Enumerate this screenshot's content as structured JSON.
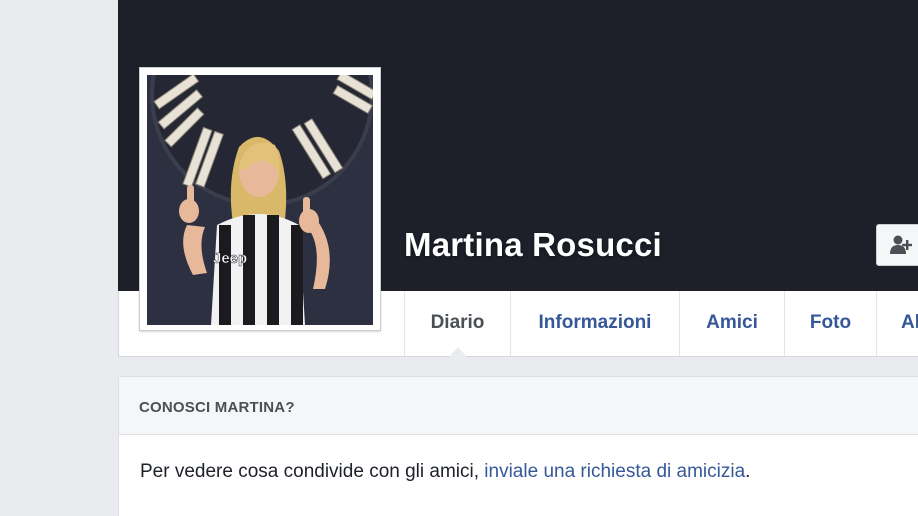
{
  "profile": {
    "name": "Martina Rosucci",
    "photo_icon": "profile-photo",
    "jersey_text": "Jeep"
  },
  "header": {
    "add_friend_icon": "add-friend-icon"
  },
  "tabs": [
    {
      "label": "Diario",
      "active": true
    },
    {
      "label": "Informazioni",
      "active": false
    },
    {
      "label": "Amici",
      "active": false
    },
    {
      "label": "Foto",
      "active": false
    },
    {
      "label": "Al",
      "active": false
    }
  ],
  "card": {
    "title": "CONOSCI MARTINA?",
    "text_before": "Per vedere cosa condivide con gli amici, ",
    "link": "inviale una richiesta di amicizia",
    "text_after": "."
  },
  "colors": {
    "cover": "#1d2029",
    "link": "#365899",
    "page_bg": "#e9ebee"
  }
}
